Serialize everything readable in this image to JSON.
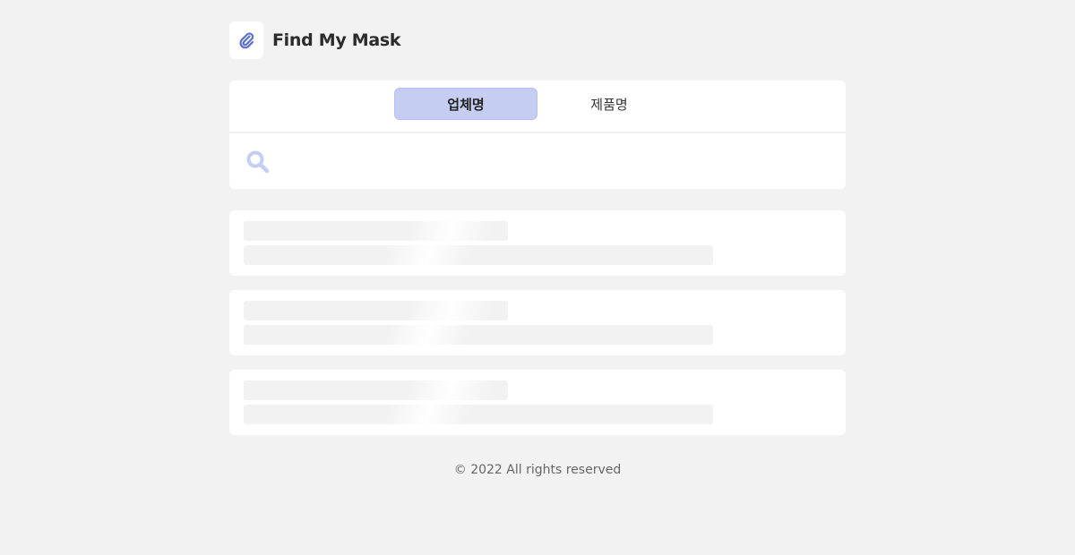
{
  "app": {
    "title": "Find My Mask",
    "logo_icon": "paperclip-icon",
    "accent_color": "#5a6fd3"
  },
  "search": {
    "tabs": [
      {
        "label": "업체명",
        "active": true
      },
      {
        "label": "제품명",
        "active": false
      }
    ],
    "placeholder": "",
    "value": "",
    "icon": "search-icon",
    "icon_color": "#c5cdf2",
    "active_tab_color": "#c5cdf2"
  },
  "results": {
    "loading": true,
    "placeholder_cards": 3
  },
  "footer": {
    "text": "© 2022 All rights reserved"
  }
}
